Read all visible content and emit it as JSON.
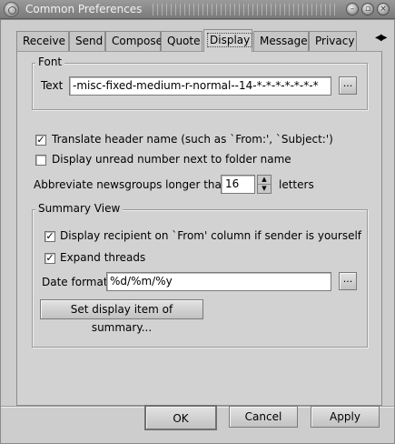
{
  "window": {
    "title": "Common Preferences"
  },
  "tabs": [
    {
      "label": "Receive"
    },
    {
      "label": "Send"
    },
    {
      "label": "Compose"
    },
    {
      "label": "Quote"
    },
    {
      "label": "Display"
    },
    {
      "label": "Message"
    },
    {
      "label": "Privacy"
    }
  ],
  "active_tab": "Display",
  "font": {
    "frame_label": "Font",
    "text_label": "Text",
    "text_value": "-misc-fixed-medium-r-normal--14-*-*-*-*-*-*-*",
    "browse_label": "..."
  },
  "options": {
    "translate_header": {
      "label": "Translate header name (such as `From:', `Subject:')",
      "checked": true
    },
    "display_unread": {
      "label": "Display unread number next to folder name",
      "checked": false
    },
    "abbreviate_label": "Abbreviate newsgroups longer than",
    "abbreviate_value": "16",
    "abbreviate_unit": "letters"
  },
  "summary": {
    "frame_label": "Summary View",
    "display_recipient": {
      "label": "Display recipient on `From' column if sender is yourself",
      "checked": true
    },
    "expand_threads": {
      "label": "Expand threads",
      "checked": true
    },
    "date_format_label": "Date format",
    "date_format_value": "%d/%m/%y",
    "browse_label": "...",
    "set_display_item_label": "Set display item of summary..."
  },
  "buttons": {
    "ok": "OK",
    "cancel": "Cancel",
    "apply": "Apply"
  },
  "checkmark": "✓"
}
